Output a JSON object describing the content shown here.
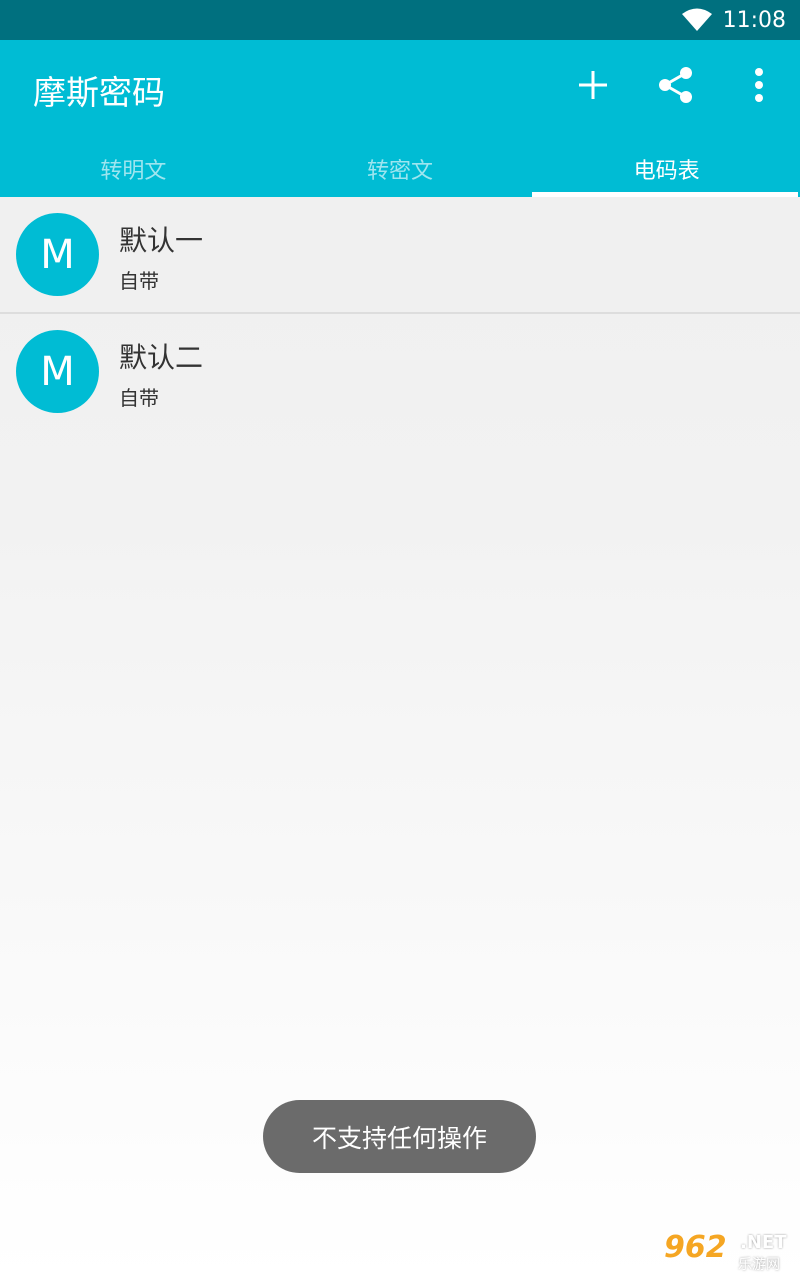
{
  "status_bar": {
    "time": "11:08",
    "wifi_icon": "wifi-icon"
  },
  "app_bar": {
    "title": "摩斯密码",
    "actions": [
      "add-icon",
      "share-icon",
      "more-vert-icon"
    ]
  },
  "tabs": [
    {
      "label": "转明文",
      "active": false
    },
    {
      "label": "转密文",
      "active": false
    },
    {
      "label": "电码表",
      "active": true
    }
  ],
  "list": [
    {
      "avatar": "M",
      "title": "默认一",
      "subtitle": "自带"
    },
    {
      "avatar": "M",
      "title": "默认二",
      "subtitle": "自带"
    }
  ],
  "toast": {
    "text": "不支持任何操作"
  },
  "watermark": {
    "number": "962",
    "suffix": ".NET",
    "site": "乐游网"
  },
  "colors": {
    "primary": "#00bcd4",
    "status_bar": "#00707f",
    "toast": "#6b6b6b",
    "text": "#333333"
  }
}
